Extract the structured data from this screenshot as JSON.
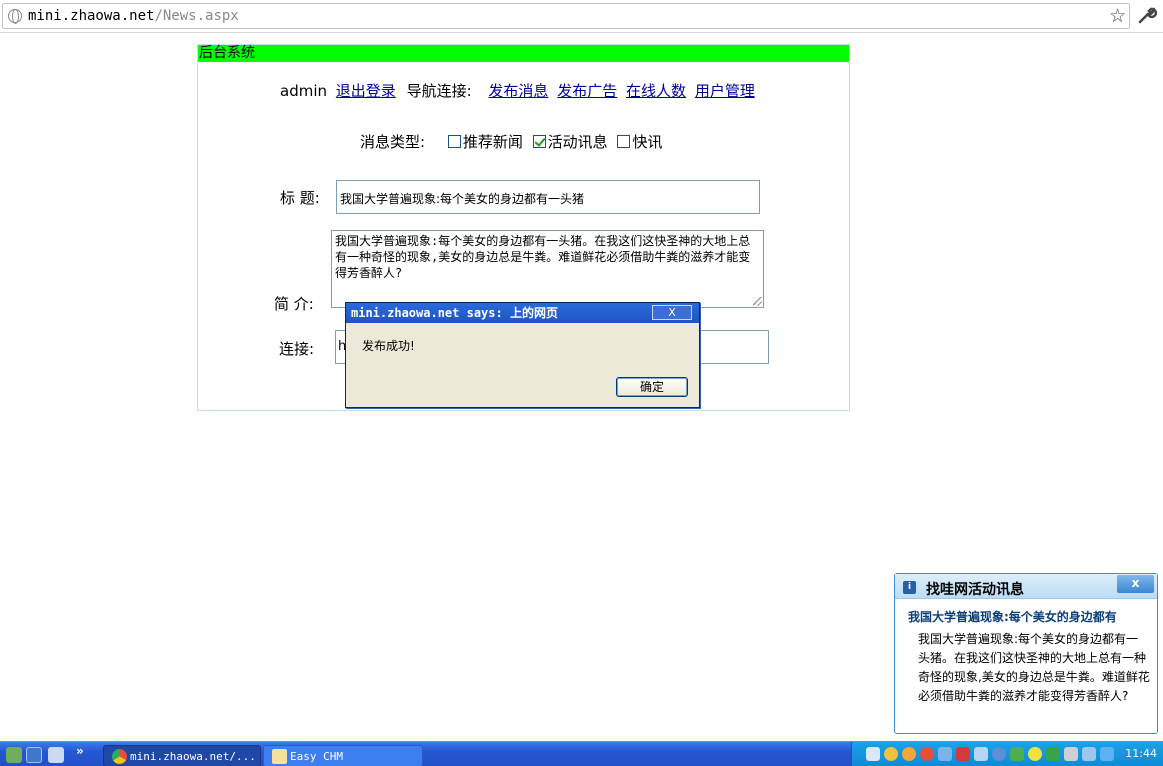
{
  "browser": {
    "url_host": "mini.zhaowa.net",
    "url_path": "/News.aspx"
  },
  "panel": {
    "title": "后台系统",
    "user": "admin",
    "logout": "退出登录",
    "nav_label": "导航连接:",
    "nav_links": [
      "发布消息",
      "发布广告",
      "在线人数",
      "用户管理"
    ],
    "type_label": "消息类型:",
    "types": [
      {
        "label": "推荐新闻",
        "checked": false
      },
      {
        "label": "活动讯息",
        "checked": true
      },
      {
        "label": "快讯",
        "checked": false
      }
    ],
    "title_label": "标 题:",
    "title_value": "我国大学普遍现象:每个美女的身边都有一头猪",
    "summary_label": "简 介:",
    "summary_value": "我国大学普遍现象:每个美女的身边都有一头猪。在我这们这快圣神的大地上总有一种奇怪的现象,美女的身边总是牛粪。难道鲜花必须借助牛粪的滋养才能变得芳香醉人?",
    "link_label": "连接:",
    "link_value": "h"
  },
  "dialog": {
    "title": "mini.zhaowa.net says: 上的网页",
    "close": "X",
    "message": "发布成功!",
    "ok": "确定"
  },
  "notification": {
    "title": "找哇网活动讯息",
    "close": "x",
    "headline": "我国大学普遍现象:每个美女的身边都有",
    "body": "我国大学普遍现象:每个美女的身边都有一头猪。在我这们这快圣神的大地上总有一种奇怪的现象,美女的身边总是牛粪。难道鲜花必须借助牛粪的滋养才能变得芳香醉人?"
  },
  "taskbar": {
    "more": "»",
    "tasks": [
      "mini.zhaowa.net/...",
      "Easy CHM"
    ],
    "clock": "11:44"
  }
}
